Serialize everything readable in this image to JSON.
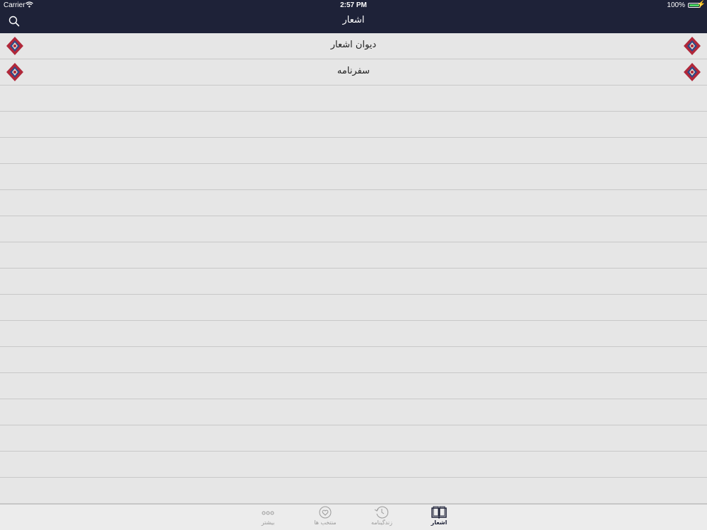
{
  "status_bar": {
    "carrier": "Carrier",
    "time": "2:57 PM",
    "battery": "100%"
  },
  "nav": {
    "title": "اشعار",
    "search_icon": "search-icon"
  },
  "list": {
    "items": [
      {
        "label": "دیوان اشعار",
        "icon": "ornament-icon"
      },
      {
        "label": "سفرنامه",
        "icon": "ornament-icon"
      }
    ],
    "empty_rows": 16
  },
  "tabbar": {
    "tabs": [
      {
        "label": "بیشتر",
        "icon": "more-icon",
        "active": false
      },
      {
        "label": "منتخب ها",
        "icon": "heart-icon",
        "active": false
      },
      {
        "label": "زندگینامه",
        "icon": "history-icon",
        "active": false
      },
      {
        "label": "اشعار",
        "icon": "book-icon",
        "active": true
      }
    ]
  },
  "colors": {
    "navbar": "#1e2238",
    "background": "#e6e6e6",
    "separator": "#c8c8c8",
    "ornament_red": "#b0283a",
    "ornament_blue": "#2e4a8a"
  }
}
